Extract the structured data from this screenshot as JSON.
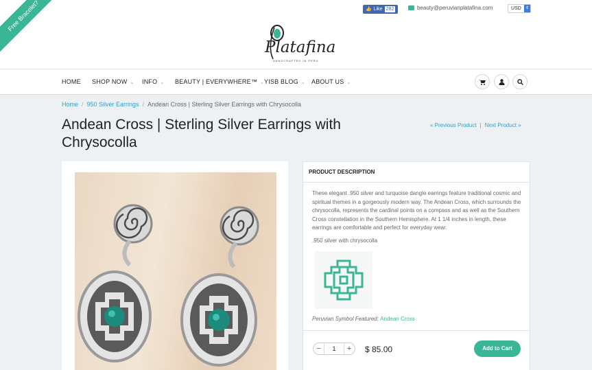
{
  "promo": {
    "ribbon": "Free Bracelet?",
    "chevron": "⌄"
  },
  "topbar": {
    "fb_like": "Like",
    "fb_count": "282",
    "email": "beauty@peruvianplatafina.com",
    "currency": "USD"
  },
  "brand": {
    "name": "Platafina",
    "tagline": "HANDCRAFTED IN PERU"
  },
  "nav": {
    "items": [
      {
        "label": "HOME",
        "dropdown": false
      },
      {
        "label": "SHOP NOW",
        "dropdown": true
      },
      {
        "label": "INFO",
        "dropdown": true
      },
      {
        "label": "BEAUTY | EVERYWHERE™",
        "dropdown": true
      },
      {
        "label": "YISB BLOG",
        "dropdown": true
      },
      {
        "label": "ABOUT US",
        "dropdown": true
      }
    ],
    "icons": [
      "cart-icon",
      "user-icon",
      "search-icon"
    ]
  },
  "breadcrumb": {
    "home": "Home",
    "category": "950 Silver Earrings",
    "current": "Andean Cross | Sterling Silver Earrings with Chrysocolla",
    "separator": "/"
  },
  "product": {
    "title": "Andean Cross | Sterling Silver Earrings with Chrysocolla",
    "prev_label": "« Previous Product",
    "next_label": "Next Product »",
    "nav_separator": "|",
    "description_header": "PRODUCT DESCRIPTION",
    "description": "These elegant .950 silver and turquoise dangle earrings feature traditional cosmic and spiritual themes in a gorgeously modern way. The Andean Cross, which surrounds the chrysocolla, represents the cardinal points on a compass and as well as the Southern Cross constellation in the Southern Hemisphere. At 1 1/4 inches in length, these earrings are comfortable and perfect for everyday wear.",
    "material": ".950 silver with chrysocolla",
    "symbol_caption": "Peruvian Symbol Featured:",
    "symbol_name": "Andean Cross",
    "quantity": "1",
    "qty_minus": "−",
    "qty_plus": "+",
    "price": "$ 85.00",
    "add_to_cart": "Add to Cart"
  },
  "colors": {
    "accent": "#3ab596",
    "link": "#2a9fd0",
    "background": "#eef1f3"
  }
}
